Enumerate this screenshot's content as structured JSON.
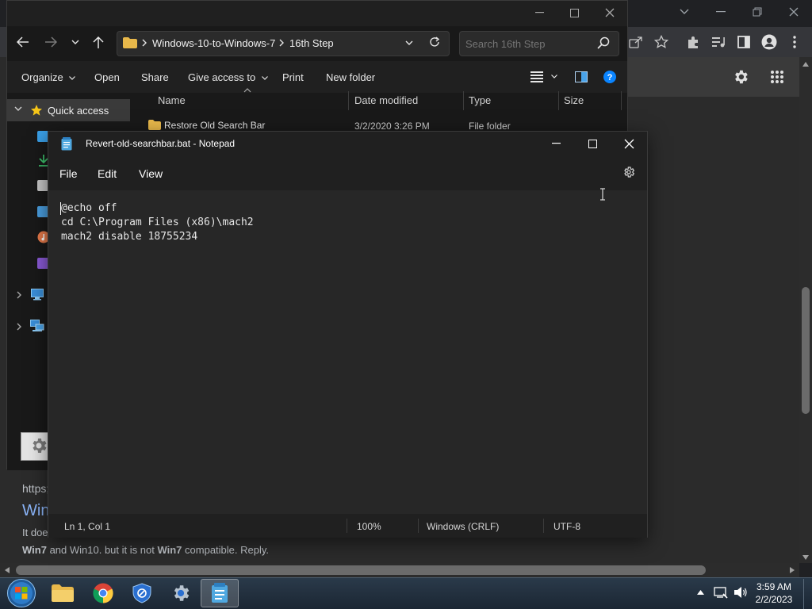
{
  "browser": {
    "page_url_fragment": "https;",
    "page_link_fragment": "Win",
    "page_text_line1_start": "It doe",
    "page_text_line2": "and Win10. but it is not",
    "page_text_line2_bold1": "Win7",
    "page_text_line2_bold2": "Win7",
    "page_text_line2_end": "compatible. Reply."
  },
  "explorer": {
    "breadcrumb": [
      "Windows-10-to-Windows-7",
      "16th Step"
    ],
    "search_placeholder": "Search 16th Step",
    "commands": [
      "Organize",
      "Open",
      "Share",
      "Give access to",
      "Print",
      "New folder"
    ],
    "quick_access_label": "Quick access",
    "columns": [
      "Name",
      "Date modified",
      "Type",
      "Size"
    ],
    "rows": [
      {
        "name": "Restore Old Search Bar",
        "date": "3/2/2020 3:26 PM",
        "type": "File folder",
        "size": ""
      }
    ]
  },
  "notepad": {
    "title": "Revert-old-searchbar.bat - Notepad",
    "menu": [
      "File",
      "Edit",
      "View"
    ],
    "lines": [
      "@echo off",
      "cd C:\\Program Files (x86)\\mach2",
      "mach2 disable 18755234"
    ],
    "status": {
      "position": "Ln 1, Col 1",
      "zoom": "100%",
      "line_ending": "Windows (CRLF)",
      "encoding": "UTF-8"
    }
  },
  "taskbar": {
    "time": "3:59 AM",
    "date": "2/2/2023",
    "apps": [
      "start-orb",
      "file-explorer",
      "chrome",
      "windows-defender",
      "settings",
      "notepad"
    ]
  },
  "colors": {
    "taskbar_bg": "#1b2633",
    "notepad_bg": "#272727",
    "explorer_bg": "#191919",
    "help_blue": "#0a84ff",
    "folder_yellow": "#e8b84a"
  }
}
